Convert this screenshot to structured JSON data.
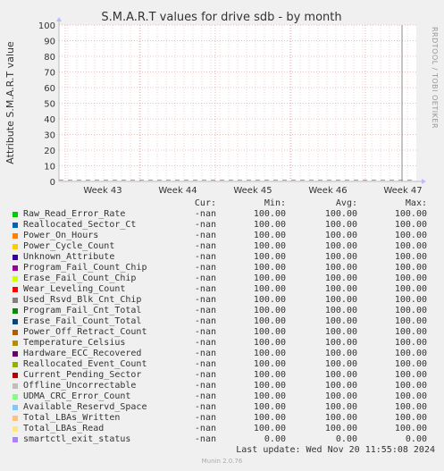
{
  "chart_data": {
    "type": "line",
    "title": "S.M.A.R.T values for drive sdb - by month",
    "ylabel": "Attribute S.M.A.R.T value",
    "xlabel": "",
    "ylim": [
      0,
      100
    ],
    "y_ticks": [
      0,
      10,
      20,
      30,
      40,
      50,
      60,
      70,
      80,
      90,
      100
    ],
    "x_ticks": [
      "Week 43",
      "Week 44",
      "Week 45",
      "Week 46",
      "Week 47"
    ],
    "grid": true,
    "headers": [
      "Cur:",
      "Min:",
      "Avg:",
      "Max:"
    ],
    "series": [
      {
        "name": "Raw_Read_Error_Rate",
        "color": "#00cc00",
        "cur": "-nan",
        "min": "100.00",
        "avg": "100.00",
        "max": "100.00"
      },
      {
        "name": "Reallocated_Sector_Ct",
        "color": "#0066b3",
        "cur": "-nan",
        "min": "100.00",
        "avg": "100.00",
        "max": "100.00"
      },
      {
        "name": "Power_On_Hours",
        "color": "#ff8000",
        "cur": "-nan",
        "min": "100.00",
        "avg": "100.00",
        "max": "100.00"
      },
      {
        "name": "Power_Cycle_Count",
        "color": "#ffcc00",
        "cur": "-nan",
        "min": "100.00",
        "avg": "100.00",
        "max": "100.00"
      },
      {
        "name": "Unknown_Attribute",
        "color": "#330099",
        "cur": "-nan",
        "min": "100.00",
        "avg": "100.00",
        "max": "100.00"
      },
      {
        "name": "Program_Fail_Count_Chip",
        "color": "#990099",
        "cur": "-nan",
        "min": "100.00",
        "avg": "100.00",
        "max": "100.00"
      },
      {
        "name": "Erase_Fail_Count_Chip",
        "color": "#ccff00",
        "cur": "-nan",
        "min": "100.00",
        "avg": "100.00",
        "max": "100.00"
      },
      {
        "name": "Wear_Leveling_Count",
        "color": "#ff0000",
        "cur": "-nan",
        "min": "100.00",
        "avg": "100.00",
        "max": "100.00"
      },
      {
        "name": "Used_Rsvd_Blk_Cnt_Chip",
        "color": "#808080",
        "cur": "-nan",
        "min": "100.00",
        "avg": "100.00",
        "max": "100.00"
      },
      {
        "name": "Program_Fail_Cnt_Total",
        "color": "#008f00",
        "cur": "-nan",
        "min": "100.00",
        "avg": "100.00",
        "max": "100.00"
      },
      {
        "name": "Erase_Fail_Count_Total",
        "color": "#00487d",
        "cur": "-nan",
        "min": "100.00",
        "avg": "100.00",
        "max": "100.00"
      },
      {
        "name": "Power_Off_Retract_Count",
        "color": "#b35a00",
        "cur": "-nan",
        "min": "100.00",
        "avg": "100.00",
        "max": "100.00"
      },
      {
        "name": "Temperature_Celsius",
        "color": "#b38f00",
        "cur": "-nan",
        "min": "100.00",
        "avg": "100.00",
        "max": "100.00"
      },
      {
        "name": "Hardware_ECC_Recovered",
        "color": "#6b006b",
        "cur": "-nan",
        "min": "100.00",
        "avg": "100.00",
        "max": "100.00"
      },
      {
        "name": "Reallocated_Event_Count",
        "color": "#8fb300",
        "cur": "-nan",
        "min": "100.00",
        "avg": "100.00",
        "max": "100.00"
      },
      {
        "name": "Current_Pending_Sector",
        "color": "#b30000",
        "cur": "-nan",
        "min": "100.00",
        "avg": "100.00",
        "max": "100.00"
      },
      {
        "name": "Offline_Uncorrectable",
        "color": "#bebebe",
        "cur": "-nan",
        "min": "100.00",
        "avg": "100.00",
        "max": "100.00"
      },
      {
        "name": "UDMA_CRC_Error_Count",
        "color": "#80ff80",
        "cur": "-nan",
        "min": "100.00",
        "avg": "100.00",
        "max": "100.00"
      },
      {
        "name": "Available_Reservd_Space",
        "color": "#80c9ff",
        "cur": "-nan",
        "min": "100.00",
        "avg": "100.00",
        "max": "100.00"
      },
      {
        "name": "Total_LBAs_Written",
        "color": "#ffc080",
        "cur": "-nan",
        "min": "100.00",
        "avg": "100.00",
        "max": "100.00"
      },
      {
        "name": "Total_LBAs_Read",
        "color": "#ffe680",
        "cur": "-nan",
        "min": "100.00",
        "avg": "100.00",
        "max": "100.00"
      },
      {
        "name": "smartctl_exit_status",
        "color": "#aa80ff",
        "cur": "-nan",
        "min": "0.00",
        "avg": "0.00",
        "max": "0.00"
      }
    ]
  },
  "sidebar_text": "RRDTOOL / TOBI OETIKER",
  "footer": {
    "last_update": "Last update: Wed Nov 20 11:55:08 2024",
    "generator": "Munin 2.0.76"
  }
}
